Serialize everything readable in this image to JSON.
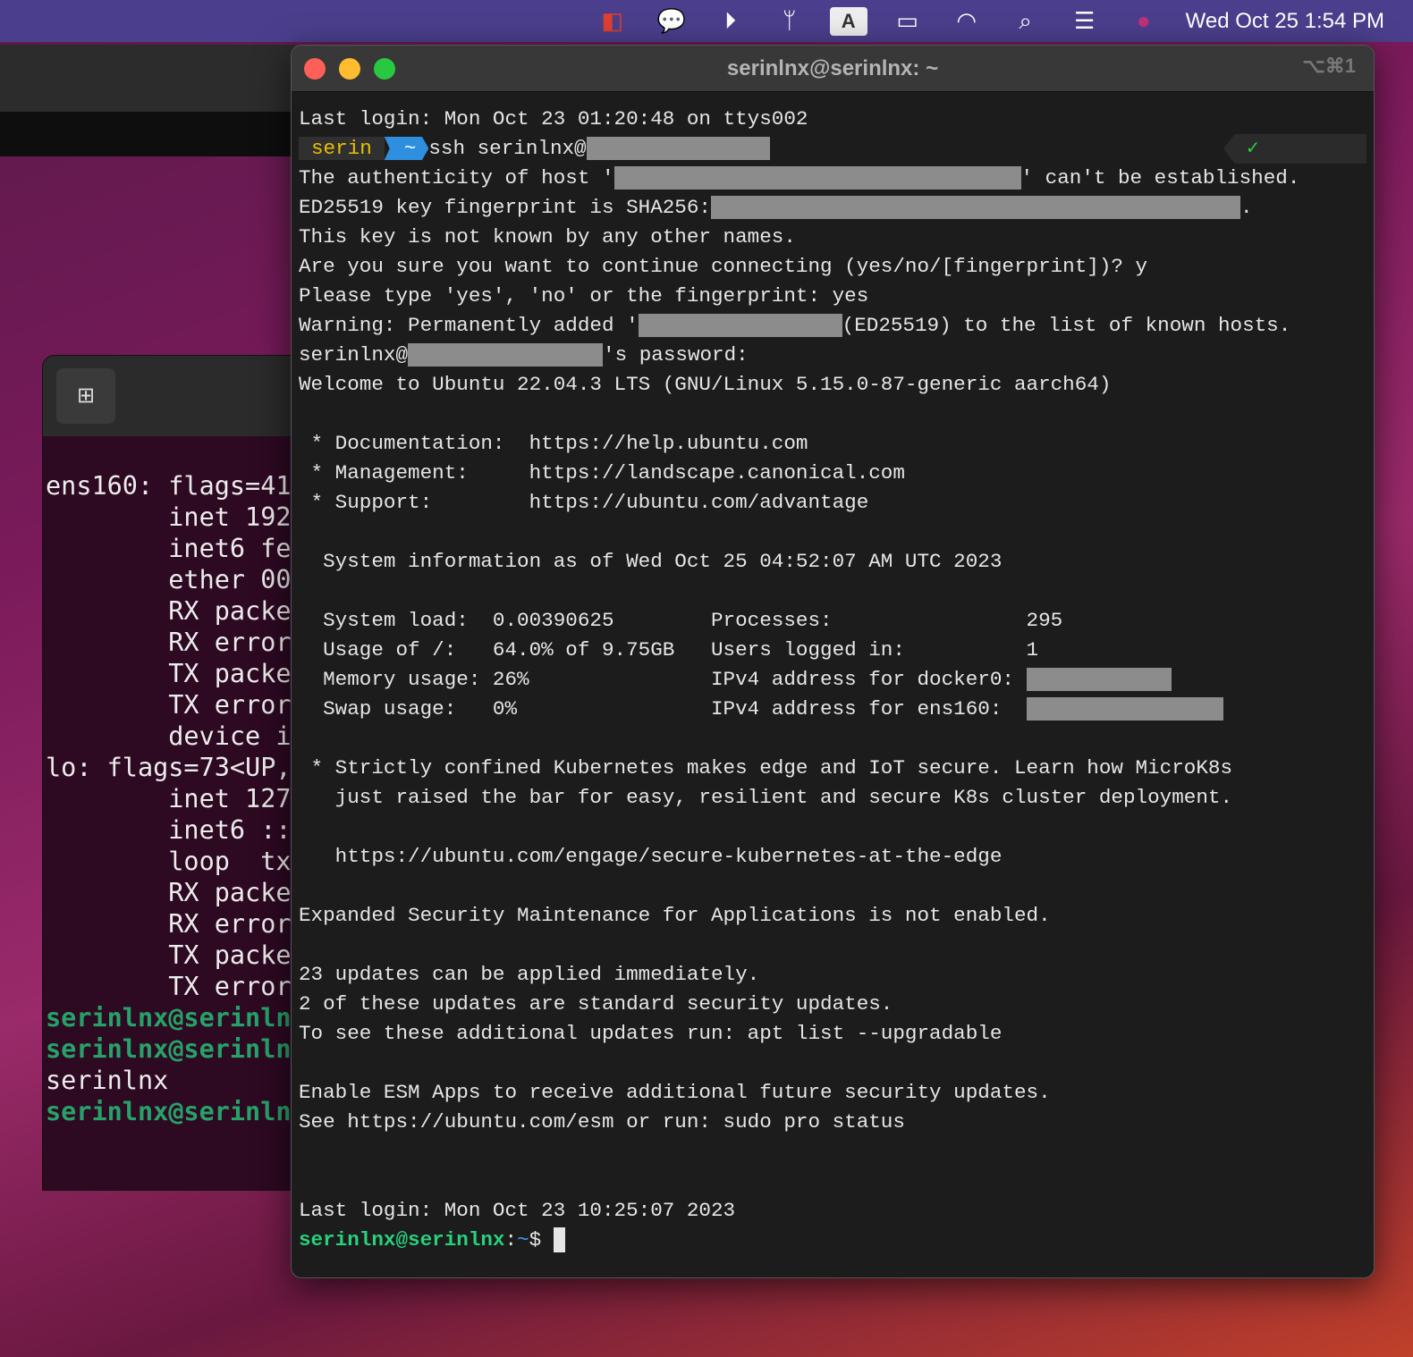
{
  "menubar": {
    "icons": [
      "parallels-icon",
      "messages-icon",
      "play-icon",
      "airpods-icon",
      "input-source-icon",
      "battery-icon",
      "wifi-icon",
      "spotlight-search-icon",
      "control-center-icon",
      "siri-icon"
    ],
    "input_source": "A",
    "clock": "Wed Oct 25  1:54 PM"
  },
  "ubuntu_terminal": {
    "lines": [
      [
        {
          "t": "ens160: flags=41"
        }
      ],
      [
        {
          "t": "        inet 192"
        }
      ],
      [
        {
          "t": "        inet6 fe"
        }
      ],
      [
        {
          "t": "        ether 00"
        }
      ],
      [
        {
          "t": "        RX packe"
        }
      ],
      [
        {
          "t": "        RX error"
        }
      ],
      [
        {
          "t": "        TX packe"
        }
      ],
      [
        {
          "t": "        TX error"
        }
      ],
      [
        {
          "t": "        device i"
        }
      ],
      [
        {
          "t": ""
        }
      ],
      [
        {
          "t": "lo: flags=73<UP,"
        }
      ],
      [
        {
          "t": "        inet 127"
        }
      ],
      [
        {
          "t": "        inet6 ::"
        }
      ],
      [
        {
          "t": "        loop  tx"
        }
      ],
      [
        {
          "t": "        RX packe"
        }
      ],
      [
        {
          "t": "        RX error"
        }
      ],
      [
        {
          "t": "        TX packe"
        }
      ],
      [
        {
          "t": "        TX error"
        }
      ],
      [
        {
          "t": ""
        }
      ],
      [
        {
          "t": "serinlnx@serinln",
          "c": "ugreen"
        }
      ],
      [
        {
          "t": "serinlnx@serinln",
          "c": "ugreen"
        }
      ],
      [
        {
          "t": "serinlnx"
        }
      ],
      [
        {
          "t": "serinlnx@serinln",
          "c": "ugreen"
        }
      ]
    ]
  },
  "terminal": {
    "title": "serinlnx@serinlnx: ~",
    "shortcut": "⌥⌘1",
    "prompt": {
      "user": "serin",
      "dir": "~",
      "command": "ssh serinlnx@",
      "status": "✓"
    },
    "lines": [
      [
        {
          "t": "Last login: Mon Oct 23 01:20:48 on ttys002"
        }
      ],
      "PROMPT",
      [
        {
          "t": "The authenticity of host '"
        },
        {
          "r": 1
        },
        {
          "t": "' can't be established."
        }
      ],
      [
        {
          "t": "ED25519 key fingerprint is SHA256:"
        },
        {
          "r": 2
        },
        {
          "t": "."
        }
      ],
      [
        {
          "t": "This key is not known by any other names."
        }
      ],
      [
        {
          "t": "Are you sure you want to continue connecting (yes/no/[fingerprint])? y"
        }
      ],
      [
        {
          "t": "Please type 'yes', 'no' or the fingerprint: yes"
        }
      ],
      [
        {
          "t": "Warning: Permanently added '"
        },
        {
          "r": 3
        },
        {
          "t": "(ED25519) to the list of known hosts."
        }
      ],
      [
        {
          "t": "serinlnx@"
        },
        {
          "r": 4
        },
        {
          "t": "'s password:"
        }
      ],
      [
        {
          "t": "Welcome to Ubuntu 22.04.3 LTS (GNU/Linux 5.15.0-87-generic aarch64)"
        }
      ],
      [
        {
          "t": ""
        }
      ],
      [
        {
          "t": " * Documentation:  https://help.ubuntu.com"
        }
      ],
      [
        {
          "t": " * Management:     https://landscape.canonical.com"
        }
      ],
      [
        {
          "t": " * Support:        https://ubuntu.com/advantage"
        }
      ],
      [
        {
          "t": ""
        }
      ],
      [
        {
          "t": "  System information as of Wed Oct 25 04:52:07 AM UTC 2023"
        }
      ],
      [
        {
          "t": ""
        }
      ],
      [
        {
          "t": "  System load:  0.00390625        Processes:                295"
        }
      ],
      [
        {
          "t": "  Usage of /:   64.0% of 9.75GB   Users logged in:          1"
        }
      ],
      [
        {
          "t": "  Memory usage: 26%               IPv4 address for docker0: "
        },
        {
          "r": 5
        }
      ],
      [
        {
          "t": "  Swap usage:   0%                IPv4 address for ens160:  "
        },
        {
          "r": 6
        }
      ],
      [
        {
          "t": ""
        }
      ],
      [
        {
          "t": " * Strictly confined Kubernetes makes edge and IoT secure. Learn how MicroK8s"
        }
      ],
      [
        {
          "t": "   just raised the bar for easy, resilient and secure K8s cluster deployment."
        }
      ],
      [
        {
          "t": ""
        }
      ],
      [
        {
          "t": "   https://ubuntu.com/engage/secure-kubernetes-at-the-edge"
        }
      ],
      [
        {
          "t": ""
        }
      ],
      [
        {
          "t": "Expanded Security Maintenance for Applications is not enabled."
        }
      ],
      [
        {
          "t": ""
        }
      ],
      [
        {
          "t": "23 updates can be applied immediately."
        }
      ],
      [
        {
          "t": "2 of these updates are standard security updates."
        }
      ],
      [
        {
          "t": "To see these additional updates run: apt list --upgradable"
        }
      ],
      [
        {
          "t": ""
        }
      ],
      [
        {
          "t": "Enable ESM Apps to receive additional future security updates."
        }
      ],
      [
        {
          "t": "See https://ubuntu.com/esm or run: sudo pro status"
        }
      ],
      [
        {
          "t": ""
        }
      ],
      [
        {
          "t": ""
        }
      ],
      [
        {
          "t": "Last login: Mon Oct 23 10:25:07 2023"
        }
      ],
      [
        {
          "t": "serinlnx@serinlnx",
          "c": "pg"
        },
        {
          "t": ":"
        },
        {
          "t": "~",
          "c": "pb"
        },
        {
          "t": "$ "
        },
        {
          "cursor": true
        }
      ]
    ]
  }
}
